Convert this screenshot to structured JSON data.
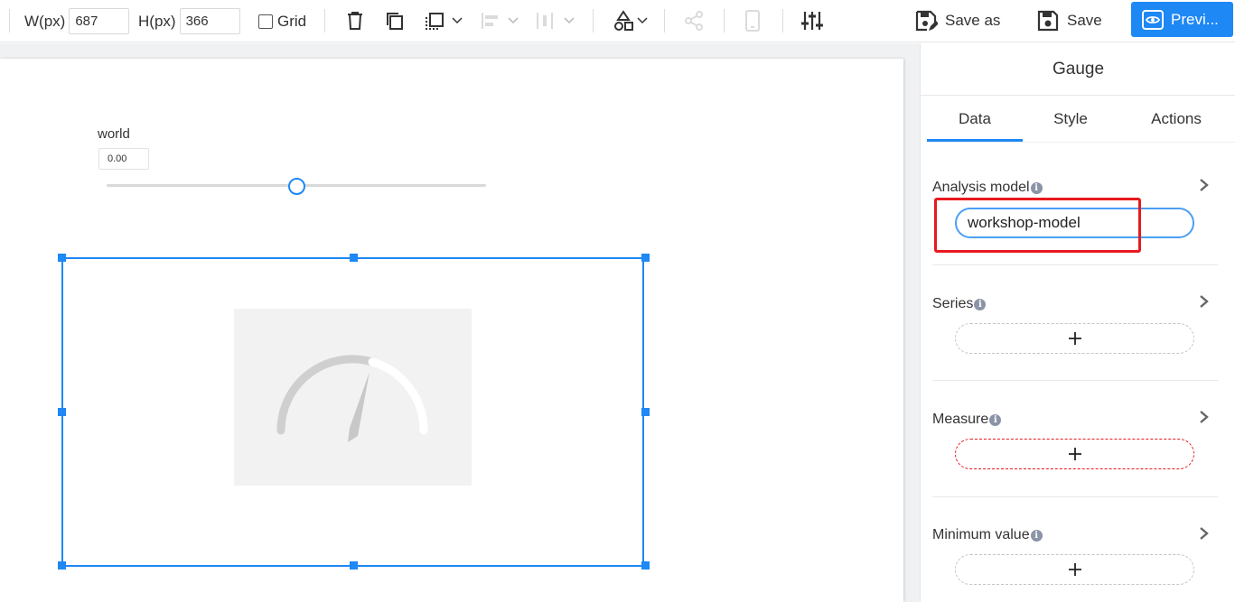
{
  "toolbar": {
    "width_label": "W(px)",
    "width_value": "687",
    "height_label": "H(px)",
    "height_value": "366",
    "grid_label": "Grid",
    "save_as_label": "Save as",
    "save_label": "Save",
    "preview_label": "Previ..."
  },
  "canvas": {
    "slider": {
      "label": "world",
      "value": "0.00",
      "position_fraction": 0.5
    }
  },
  "panel": {
    "title": "Gauge",
    "tabs": [
      "Data",
      "Style",
      "Actions"
    ],
    "active_tab": "Data",
    "sections": {
      "analysis_model": {
        "label": "Analysis model",
        "value": "workshop-model"
      },
      "series": {
        "label": "Series"
      },
      "measure": {
        "label": "Measure"
      },
      "minimum_value": {
        "label": "Minimum value"
      }
    }
  },
  "colors": {
    "accent": "#1e88f5",
    "highlight": "#e8191f"
  },
  "icons": {
    "info": "i",
    "add": "+"
  }
}
